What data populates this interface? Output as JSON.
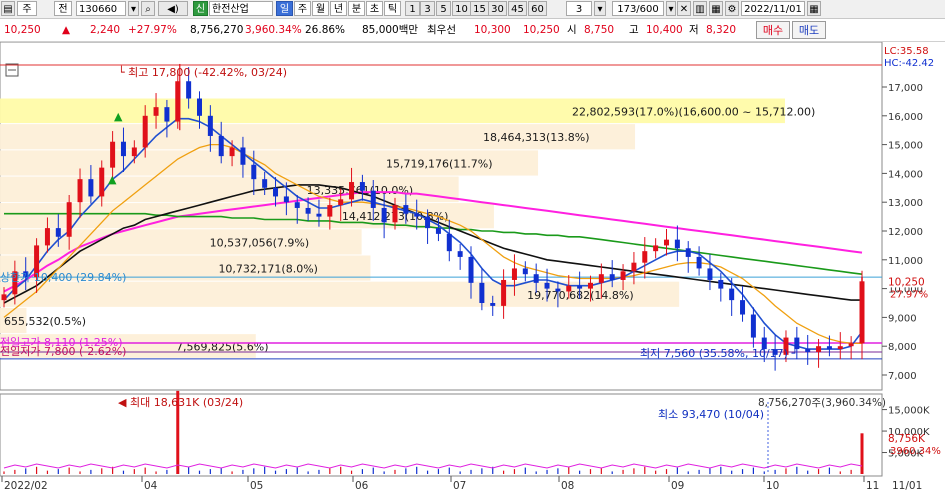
{
  "toolbar": {
    "mode": "주",
    "market": "전",
    "code": "130660",
    "sound_icon": "speaker-icon",
    "credit_badge": "신",
    "stock_name": "한전산업",
    "periods": [
      "일",
      "주",
      "월",
      "년",
      "분",
      "초",
      "틱"
    ],
    "selected_period": "일",
    "intervals": [
      "1",
      "3",
      "5",
      "10",
      "15",
      "30",
      "45",
      "60"
    ],
    "interval_value": "3",
    "page_count": "173/600",
    "date": "2022/11/01",
    "icons": [
      "chart-type-icon",
      "bar-chart-icon",
      "save-icon",
      "layout-icon",
      "compare-icon",
      "indicator-icon",
      "settings-icon"
    ]
  },
  "quote": {
    "price": "10,250",
    "arrow": "▲",
    "change": "2,240",
    "change_rate": "+27.97%",
    "volume": "8,756,270",
    "volume_ratio": "3,960.34%",
    "turnover": "26.86%",
    "amount": "85,000백만",
    "best_label": "최우선",
    "best_ask": "10,300",
    "best_bid": "10,250",
    "open_label": "시",
    "open": "8,750",
    "high_label": "고",
    "high": "10,400",
    "low_label": "저",
    "low": "8,320",
    "buy_button": "매수",
    "sell_button": "매도"
  },
  "chart_data": {
    "type": "candlestick",
    "x_labels": [
      "2022/02",
      "04",
      "05",
      "06",
      "07",
      "08",
      "09",
      "10",
      "11"
    ],
    "price_ticks": [
      "17,000",
      "16,000",
      "15,000",
      "14,000",
      "13,000",
      "12,000",
      "11,000",
      "10,000",
      "9,000",
      "8,000",
      "7,000"
    ],
    "ylim": [
      7000,
      18000
    ],
    "volume_ticks": [
      "15,000K",
      "10,000K",
      "5,000K"
    ],
    "top_legend": [
      "LC:35.58",
      "HC:-42.42"
    ],
    "current_price_label": "10,250",
    "current_rate_label": "27.97%",
    "current_volume_label": "8,756K",
    "current_volume_ratio_label": "3960.34%",
    "annotations": {
      "high": "최고 17,800 (-42.42%, 03/24)",
      "low": "최저 7,560 (35.58%, 10/17)",
      "upper_limit": "상한가 10,400 (29.84%)",
      "prev_high": "전일고가 8,110 (1.25%)",
      "prev_low": "전일저가 7,800 (-2.62%)",
      "max_volume": "최대 18,631K (03/24)",
      "min_volume": "최소 93,470 (10/04)",
      "cur_volume": "8,756,270주(3,960.34%)"
    },
    "volume_profile": [
      {
        "label": "22,802,593(17.0%)(16,600.00 ~ 15,712.00)",
        "low": 15712,
        "high": 16600,
        "width": 0.89
      },
      {
        "label": "18,464,313(13.8%)",
        "low": 14800,
        "high": 15712,
        "width": 0.72
      },
      {
        "label": "15,719,176(11.7%)",
        "low": 13890,
        "high": 14800,
        "width": 0.61
      },
      {
        "label": "13,335,761(10.0%)",
        "low": 12970,
        "high": 13890,
        "width": 0.52
      },
      {
        "label": "14,412,273(10.8%)",
        "low": 12060,
        "high": 12970,
        "width": 0.56
      },
      {
        "label": "10,537,056(7.9%)",
        "low": 11150,
        "high": 12060,
        "width": 0.41
      },
      {
        "label": "10,732,171(8.0%)",
        "low": 10240,
        "high": 11150,
        "width": 0.42
      },
      {
        "label": "19,770,682(14.8%)",
        "low": 9330,
        "high": 10240,
        "width": 0.77
      },
      {
        "label": "655,532(0.5%)",
        "low": 8420,
        "high": 9330,
        "width": 0.03
      },
      {
        "label": "7,569,825(5.6%)",
        "low": 7560,
        "high": 8420,
        "width": 0.29
      }
    ],
    "high_value": 17800,
    "low_value": 7560,
    "upper_limit_value": 10400,
    "prev_high_value": 8110,
    "prev_low_value": 7800,
    "current_value": 10250,
    "close_series": [
      9800,
      10600,
      10400,
      11500,
      12100,
      11800,
      13000,
      13800,
      13200,
      14200,
      15100,
      14600,
      14900,
      16000,
      16300,
      15800,
      17200,
      16600,
      16000,
      15300,
      14600,
      14900,
      14300,
      13800,
      13500,
      13200,
      13000,
      12800,
      12600,
      12500,
      12900,
      13100,
      13700,
      13400,
      12800,
      12300,
      12900,
      12600,
      12500,
      12100,
      11900,
      11300,
      11100,
      10200,
      9500,
      9400,
      10300,
      10700,
      10500,
      10200,
      10000,
      9900,
      10100,
      10000,
      10200,
      10500,
      10300,
      10600,
      10900,
      11300,
      11500,
      11700,
      11400,
      11100,
      10700,
      10300,
      10000,
      9600,
      9100,
      8300,
      7900,
      7700,
      8300,
      7900,
      7800,
      8000,
      7900,
      8000,
      8100,
      10250
    ],
    "ma5": [
      9600,
      10000,
      10300,
      10800,
      11300,
      11700,
      12000,
      12500,
      12900,
      13300,
      13800,
      14100,
      14500,
      14900,
      15300,
      15600,
      15900,
      15900,
      15800,
      15600,
      15300,
      15000,
      14700,
      14400,
      14100,
      13800,
      13500,
      13200,
      13000,
      12800,
      12800,
      12900,
      13000,
      13100,
      13000,
      12900,
      12800,
      12700,
      12600,
      12400,
      12200,
      11900,
      11600,
      11200,
      10700,
      10300,
      10100,
      10100,
      10200,
      10300,
      10300,
      10200,
      10100,
      10100,
      10100,
      10200,
      10300,
      10400,
      10600,
      10800,
      11000,
      11200,
      11300,
      11300,
      11200,
      10900,
      10600,
      10200,
      9800,
      9300,
      8800,
      8400,
      8100,
      8000,
      7900,
      7900,
      7900,
      7900,
      8000,
      8500
    ],
    "ma20": [
      9000,
      9300,
      9600,
      9900,
      10300,
      10700,
      11100,
      11500,
      11900,
      12300,
      12700,
      13000,
      13300,
      13600,
      13900,
      14200,
      14500,
      14700,
      14900,
      15000,
      15000,
      14900,
      14700,
      14500,
      14300,
      14000,
      13800,
      13600,
      13400,
      13200,
      13100,
      13000,
      13000,
      13000,
      12950,
      12900,
      12850,
      12800,
      12700,
      12600,
      12500,
      12350,
      12200,
      12000,
      11700,
      11400,
      11100,
      10900,
      10750,
      10650,
      10550,
      10450,
      10400,
      10350,
      10350,
      10350,
      10350,
      10400,
      10450,
      10550,
      10650,
      10750,
      10850,
      10900,
      10900,
      10850,
      10750,
      10550,
      10350,
      10050,
      9750,
      9400,
      9100,
      8800,
      8600,
      8400,
      8250,
      8150,
      8100,
      8100
    ],
    "ma60": [
      9500,
      9700,
      9900,
      10100,
      10400,
      10700,
      11000,
      11300,
      11500,
      11700,
      11900,
      12100,
      12200,
      12400,
      12500,
      12600,
      12700,
      12800,
      12900,
      13000,
      13100,
      13200,
      13300,
      13400,
      13450,
      13500,
      13550,
      13600,
      13600,
      13600,
      13550,
      13500,
      13400,
      13300,
      13200,
      13050,
      12900,
      12750,
      12600,
      12450,
      12300,
      12150,
      12000,
      11850,
      11700,
      11550,
      11400,
      11300,
      11200,
      11100,
      11000,
      10950,
      10900,
      10850,
      10800,
      10750,
      10700,
      10650,
      10600,
      10550,
      10500,
      10450,
      10400,
      10350,
      10300,
      10250,
      10200,
      10150,
      10100,
      10050,
      10000,
      9950,
      9900,
      9850,
      9800,
      9750,
      9700,
      9650,
      9600,
      9600
    ],
    "ma120": [
      12600,
      12600,
      12600,
      12600,
      12600,
      12600,
      12600,
      12600,
      12600,
      12600,
      12600,
      12600,
      12600,
      12600,
      12550,
      12550,
      12500,
      12500,
      12500,
      12500,
      12500,
      12450,
      12450,
      12450,
      12400,
      12400,
      12400,
      12400,
      12350,
      12350,
      12350,
      12300,
      12300,
      12300,
      12250,
      12250,
      12200,
      12200,
      12150,
      12150,
      12100,
      12100,
      12050,
      12050,
      12000,
      12000,
      11950,
      11950,
      11900,
      11900,
      11850,
      11850,
      11800,
      11800,
      11750,
      11700,
      11650,
      11600,
      11550,
      11500,
      11450,
      11400,
      11350,
      11300,
      11250,
      11200,
      11150,
      11100,
      11050,
      11000,
      10950,
      10900,
      10850,
      10800,
      10750,
      10700,
      10650,
      10600,
      10550,
      10500
    ],
    "ma240": [
      9900,
      10100,
      10300,
      10550,
      10800,
      11000,
      11250,
      11450,
      11600,
      11750,
      11900,
      12000,
      12100,
      12200,
      12300,
      12400,
      12500,
      12550,
      12600,
      12650,
      12700,
      12750,
      12800,
      12850,
      12900,
      12950,
      13000,
      13050,
      13100,
      13150,
      13200,
      13250,
      13300,
      13350,
      13350,
      13350,
      13350,
      13300,
      13300,
      13250,
      13200,
      13150,
      13100,
      13050,
      13000,
      12950,
      12900,
      12850,
      12800,
      12750,
      12700,
      12650,
      12600,
      12550,
      12500,
      12450,
      12400,
      12350,
      12300,
      12250,
      12200,
      12150,
      12100,
      12050,
      12000,
      11950,
      11900,
      11850,
      11800,
      11750,
      11700,
      11650,
      11600,
      11550,
      11500,
      11450,
      11400,
      11350,
      11300,
      11250
    ]
  }
}
